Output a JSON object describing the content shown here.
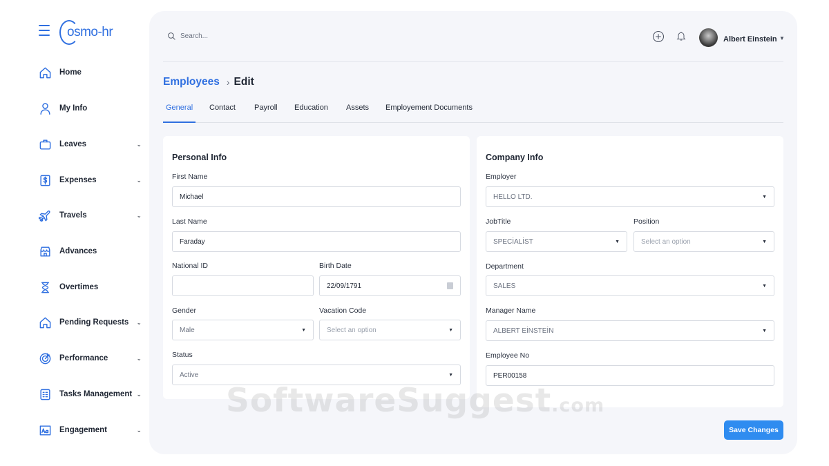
{
  "brand": {
    "logo_text": "osmo-hr",
    "logo_letter": "C",
    "color": "#2f6fe0"
  },
  "sidebar": {
    "items": [
      {
        "label": "Home",
        "icon": "home-icon",
        "chevron": false
      },
      {
        "label": "My Info",
        "icon": "user-icon",
        "chevron": false
      },
      {
        "label": "Leaves",
        "icon": "briefcase-icon",
        "chevron": true
      },
      {
        "label": "Expenses",
        "icon": "dollar-receipt-icon",
        "chevron": true
      },
      {
        "label": "Travels",
        "icon": "airplane-icon",
        "chevron": true
      },
      {
        "label": "Advances",
        "icon": "store-icon",
        "chevron": false
      },
      {
        "label": "Overtimes",
        "icon": "hourglass-icon",
        "chevron": false
      },
      {
        "label": "Pending Requests",
        "icon": "home-icon",
        "chevron": true
      },
      {
        "label": "Performance",
        "icon": "target-icon",
        "chevron": true
      },
      {
        "label": "Tasks Management",
        "icon": "checklist-icon",
        "chevron": true
      },
      {
        "label": "Engagement",
        "icon": "text-aa-icon",
        "chevron": true
      }
    ],
    "chevron_glyph": "⌄"
  },
  "topbar": {
    "search_placeholder": "Search...",
    "user_name": "Albert Einstein"
  },
  "breadcrumb": {
    "parent": "Employees",
    "current": "Edit"
  },
  "tabs": [
    {
      "label": "General",
      "active": true
    },
    {
      "label": "Contact",
      "active": false
    },
    {
      "label": "Payroll",
      "active": false
    },
    {
      "label": "Education",
      "active": false
    },
    {
      "label": "Assets",
      "active": false
    },
    {
      "label": "Employement Documents",
      "active": false
    }
  ],
  "personal_info": {
    "title": "Personal Info",
    "first_name_label": "First Name",
    "first_name": "Michael",
    "last_name_label": "Last Name",
    "last_name": "Faraday",
    "national_id_label": "National ID",
    "national_id": "",
    "birth_date_label": "Birth Date",
    "birth_date": "22/09/1791",
    "gender_label": "Gender",
    "gender": "Male",
    "vacation_code_label": "Vacation Code",
    "vacation_code_placeholder": "Select an option",
    "status_label": "Status",
    "status": "Active"
  },
  "company_info": {
    "title": "Company Info",
    "employer_label": "Employer",
    "employer": "HELLO LTD.",
    "job_title_label": "JobTitle",
    "job_title": "SPECİALİST",
    "position_label": "Position",
    "position_placeholder": "Select an option",
    "department_label": "Department",
    "department": "SALES",
    "manager_label": "Manager Name",
    "manager": "ALBERT EİNSTEİN",
    "employee_no_label": "Employee No",
    "employee_no": "PER00158"
  },
  "actions": {
    "save_label": "Save Changes",
    "save_color": "#2f8cf0"
  },
  "watermark": {
    "text": "SoftwareSuggest",
    "suffix": ".com"
  }
}
